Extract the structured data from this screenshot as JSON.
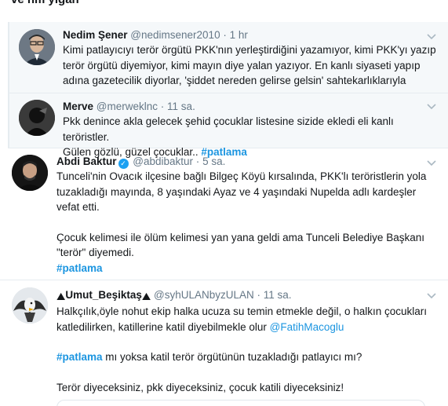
{
  "section_heading": "ve hm yiğan",
  "tweets": [
    {
      "name": "Nedim Şener",
      "handle": "@nedimsener2010",
      "sep": "·",
      "time": "1 hr",
      "avatar_icon": "avatar-photo-icon",
      "lines": [
        "Kimi patlayıcıyı terör örgütü PKK'nın yerleştirdiğini yazamıyor, kimi PKK'yı yazıp",
        "terör örgütü diyemiyor, kimi mayın diye yalan yazıyor. En kanlı siyaseti yapıp",
        "adına gazetecilik diyorlar, 'şiddet nereden gelirse gelsin' sahtekarlıklarıyla"
      ]
    },
    {
      "name": "Merve",
      "handle": "@merweklnc",
      "sep": "·",
      "time": "11 sa.",
      "line1": "Pkk denince akla gelecek şehid çocuklar listesine sizide ekledi eli kanlı teröristler.",
      "line2_text": "Gülen gözlü, güzel çocuklar.. ",
      "line2_tag": "#patlama"
    },
    {
      "name": "Abdi Baktur",
      "verified_glyph": "✓",
      "handle": "@abdibaktur",
      "sep": "·",
      "time": "5 sa.",
      "para1": [
        "Tunceli'nin Ovacık ilçesine bağlı Bilgeç Köyü kırsalında, PKK'lı teröristlerin yola",
        "tuzakladığı mayında, 8 yaşındaki Ayaz ve 4 yaşındaki Nupelda adlı kardeşler",
        "vefat etti."
      ],
      "para2": [
        "Çocuk kelimesi ile ölüm kelimesi yan yana geldi ama Tunceli Belediye Başkanı",
        "\"terör\" diyemedi."
      ],
      "tag": "#patlama"
    },
    {
      "name_prefix_emoji": "⛰",
      "name": "Umut_Beşiktaş",
      "name_suffix_emoji": "⛰",
      "handle": "@syhULANbyzULAN",
      "sep": "·",
      "time": "11 sa.",
      "line1": "Halkçılık,öyle nohut ekip halka ucuza su temin etmekle değil, o halkın çocukları",
      "line2_text": "katledilirken, katillerine katil diyebilmekle olur ",
      "line2_mention": "@FatihMacoglu",
      "line3_tag": "#patlama",
      "line3_text": " mı yoksa katil terör örgütünün tuzakladığı patlayıcı mı?",
      "line4": "Terör diyeceksiniz, pkk diyeceksiniz, çocuk katili diyeceksiniz!"
    }
  ],
  "colors": {
    "link": "#1b95e0",
    "secondary_text": "#657786",
    "border": "#e6ecf0",
    "tint": "#f5f8fa",
    "verified": "#1da1f2"
  }
}
